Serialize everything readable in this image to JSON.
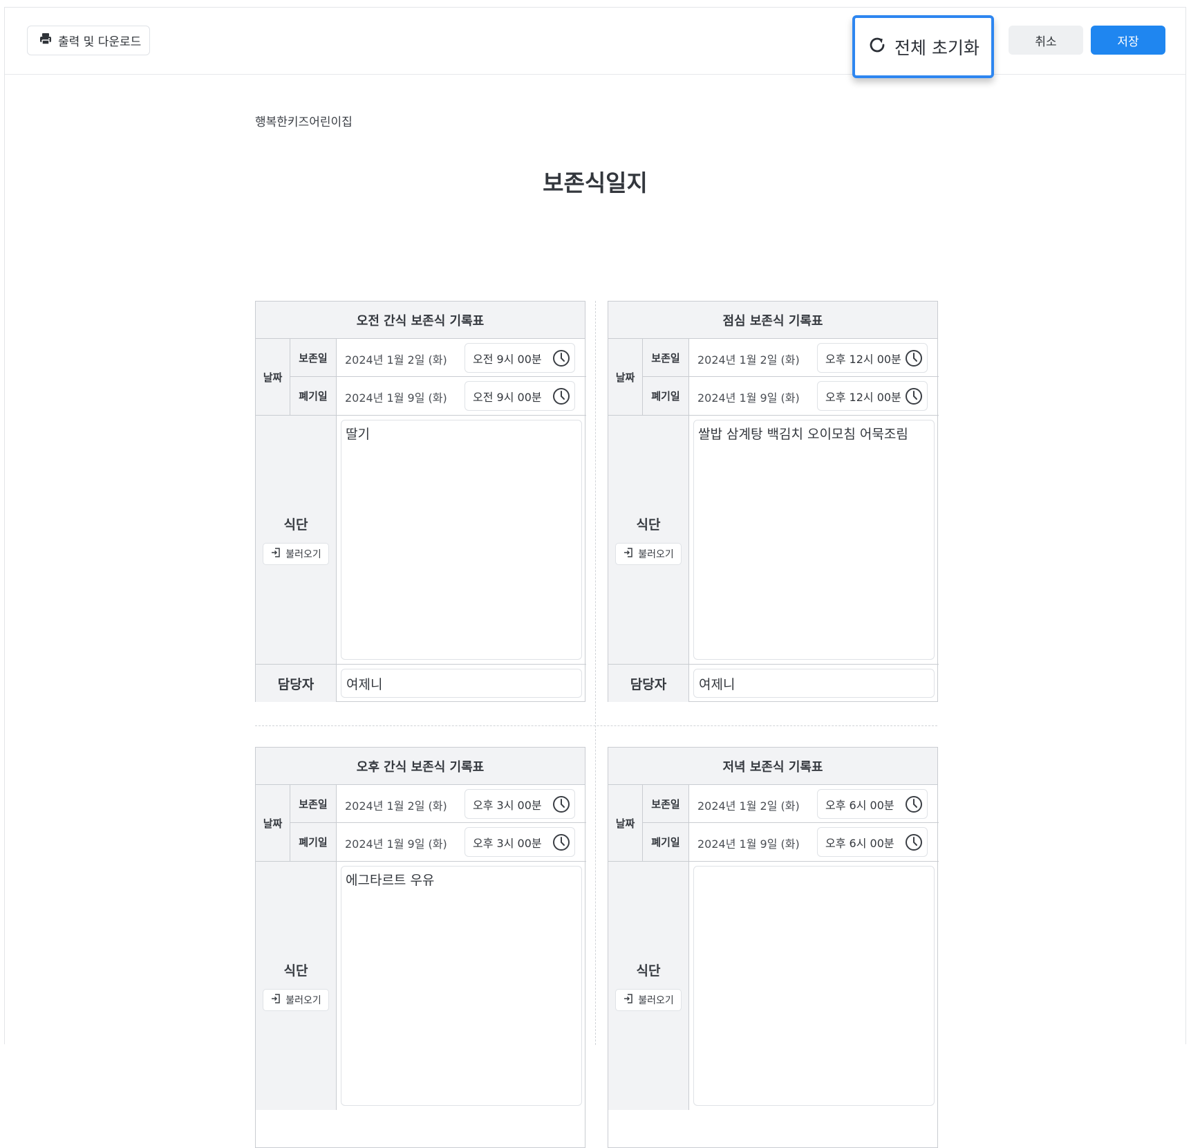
{
  "toolbar": {
    "print_label": "출력 및 다운로드",
    "reset_label": "전체 초기화",
    "cancel_label": "취소",
    "save_label": "저장"
  },
  "document": {
    "org_name": "행복한키즈어린이집",
    "title": "보존식일지"
  },
  "labels": {
    "date": "날짜",
    "stored": "보존일",
    "discard": "폐기일",
    "menu": "식단",
    "load": "불러오기",
    "manager": "담당자"
  },
  "cards": [
    {
      "title": "오전 간식 보존식 기록표",
      "stored_date": "2024년 1월 2일 (화)",
      "stored_time": "오전 9시 00분",
      "discard_date": "2024년 1월 9일 (화)",
      "discard_time": "오전 9시 00분",
      "menu": "딸기",
      "manager": "여제니"
    },
    {
      "title": "점심 보존식 기록표",
      "stored_date": "2024년 1월 2일 (화)",
      "stored_time": "오후 12시 00분",
      "discard_date": "2024년 1월 9일 (화)",
      "discard_time": "오후 12시 00분",
      "menu": "쌀밥 삼계탕 백김치 오이모침 어묵조림",
      "manager": "여제니"
    },
    {
      "title": "오후 간식 보존식 기록표",
      "stored_date": "2024년 1월 2일 (화)",
      "stored_time": "오후 3시 00분",
      "discard_date": "2024년 1월 9일 (화)",
      "discard_time": "오후 3시 00분",
      "menu": "에그타르트 우유",
      "manager": ""
    },
    {
      "title": "저녁 보존식 기록표",
      "stored_date": "2024년 1월 2일 (화)",
      "stored_time": "오후 6시 00분",
      "discard_date": "2024년 1월 9일 (화)",
      "discard_time": "오후 6시 00분",
      "menu": "",
      "manager": ""
    }
  ],
  "colors": {
    "accent": "#1f86f0",
    "focus_border": "#2e86f0",
    "header_bg": "#f2f3f5",
    "border": "#c9ccd1"
  },
  "icons": {
    "print": "printer-icon",
    "reset": "refresh-icon",
    "time": "clock-icon",
    "load": "import-icon"
  }
}
